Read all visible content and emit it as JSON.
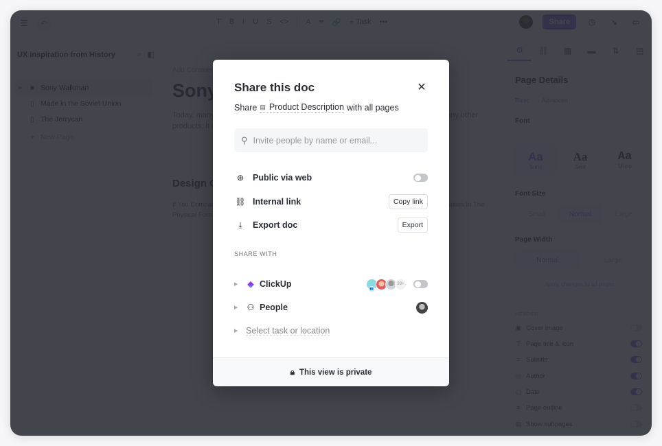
{
  "app": {
    "toolbar": {
      "items": [
        "T",
        "B",
        "I",
        "U",
        "S",
        "<>",
        "A",
        "≡",
        "🔗",
        "+ Task",
        "•••"
      ],
      "task_label": "+ Task"
    },
    "share_button": "Share",
    "sidebar": {
      "title": "UX inspiration from History",
      "items": [
        {
          "label": "Sony Walkman",
          "icon": "gamepad-icon",
          "active": true
        },
        {
          "label": "Made in the Soviet Union",
          "icon": "document-icon"
        },
        {
          "label": "The Jerrycan",
          "icon": "document-icon"
        }
      ],
      "new_page": "New Page"
    },
    "doc": {
      "comment": "Add Comment",
      "title": "Sony Walkman",
      "intro": "Today, many of us use devices that were influenced by the Sony Walkman. Like many other products, it inspired a generation of portable music players to come.",
      "h2": "Design Choices",
      "body": "If You Compare The Sony Walkman To Modern Devices Of Its Kind, You Will See A Lot Of Similarities In The Physical Form, Placement Of Buttons And Overall Look And Feel."
    },
    "right_panel": {
      "title": "Page Details",
      "subtabs": [
        "Basic",
        "Advanced"
      ],
      "font_label": "Font",
      "fonts": [
        {
          "sample": "Aa",
          "name": "Sans",
          "active": true
        },
        {
          "sample": "Aa",
          "name": "Serif"
        },
        {
          "sample": "Aa",
          "name": "Mono"
        }
      ],
      "font_size_label": "Font Size",
      "font_sizes": [
        "Small",
        "Normal",
        "Large"
      ],
      "font_size_selected": "Normal",
      "page_width_label": "Page Width",
      "page_widths": [
        "Normal",
        "Large"
      ],
      "page_width_selected": "Normal",
      "apply_all": "Apply changes to all pages",
      "header_section": "HEADER",
      "header_options": [
        {
          "label": "Cover image",
          "icon": "image-icon",
          "on": false
        },
        {
          "label": "Page title & Icon",
          "icon": "title-icon",
          "on": true
        },
        {
          "label": "Subtitle",
          "icon": "subtitle-icon",
          "on": true
        },
        {
          "label": "Author",
          "icon": "user-circle-icon",
          "on": true
        },
        {
          "label": "Date",
          "icon": "calendar-icon",
          "on": true
        },
        {
          "label": "Page outline",
          "icon": "list-icon",
          "on": false
        },
        {
          "label": "Show subpages",
          "icon": "subpages-icon",
          "on": false
        }
      ]
    }
  },
  "modal": {
    "title": "Share this doc",
    "subtitle_prefix": "Share",
    "doc_name": "Product Description",
    "subtitle_suffix": "with all pages",
    "search_placeholder": "Invite people by name or email...",
    "options": [
      {
        "label": "Public via web",
        "icon": "globe-icon",
        "control": "toggle",
        "on": false
      },
      {
        "label": "Internal link",
        "icon": "link-icon",
        "control": "button",
        "button_label": "Copy link"
      },
      {
        "label": "Export doc",
        "icon": "download-icon",
        "control": "button",
        "button_label": "Export"
      }
    ],
    "share_with_label": "SHARE WITH",
    "share_with": [
      {
        "label": "ClickUp",
        "icon": "clickup-logo-icon",
        "extra_count": "39+",
        "toggle_on": false
      },
      {
        "label": "People",
        "icon": "person-icon"
      },
      {
        "label": "Select task or location",
        "placeholder": true
      }
    ],
    "footer": "This view is private"
  }
}
